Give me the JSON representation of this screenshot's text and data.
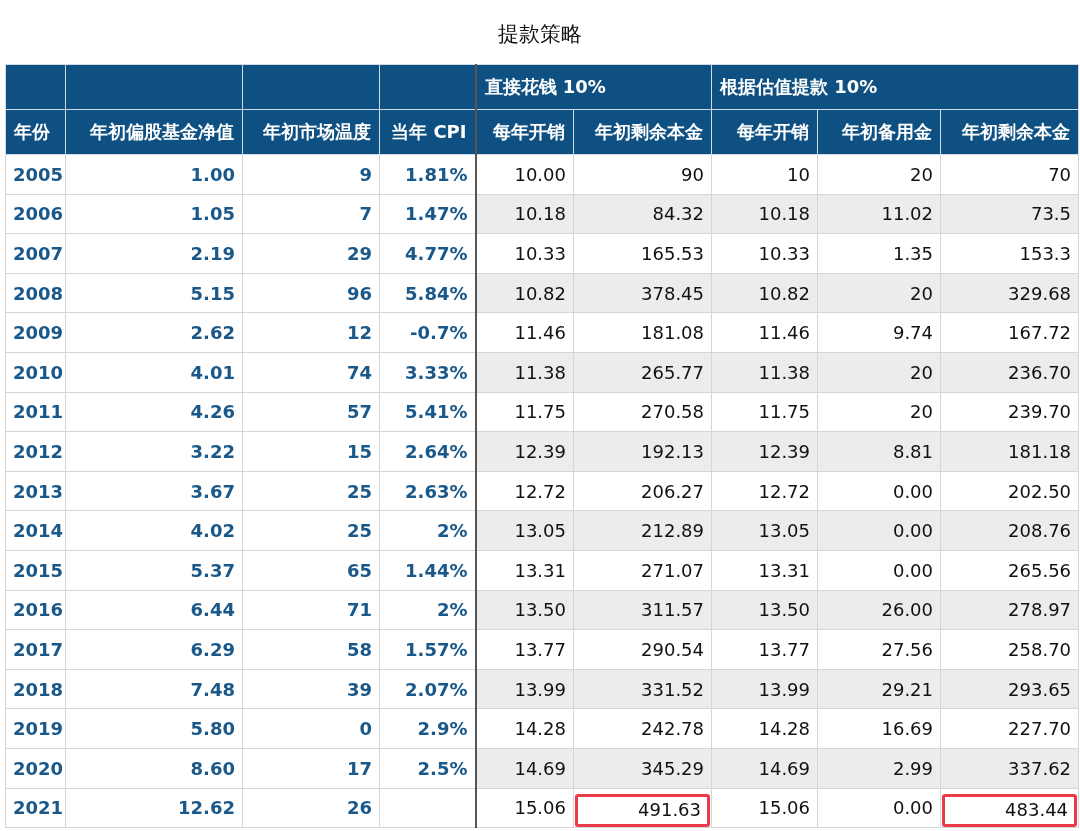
{
  "title": "提款策略",
  "groups": [
    {
      "label": "直接花钱 10%"
    },
    {
      "label": "根据估值提款 10%"
    }
  ],
  "columns": [
    "年份",
    "年初偏股基金净值",
    "年初市场温度",
    "当年 CPI",
    "每年开销",
    "年初剩余本金",
    "每年开销",
    "年初备用金",
    "年初剩余本金"
  ],
  "rows": [
    {
      "year": "2005",
      "nav": "1.00",
      "temp": "9",
      "cpi": "1.81%",
      "spend_a": "10.00",
      "remain_a": "90",
      "spend_b": "10",
      "reserve_b": "20",
      "remain_b": "70",
      "shaded": false,
      "highlighted": false
    },
    {
      "year": "2006",
      "nav": "1.05",
      "temp": "7",
      "cpi": "1.47%",
      "spend_a": "10.18",
      "remain_a": "84.32",
      "spend_b": "10.18",
      "reserve_b": "11.02",
      "remain_b": "73.5",
      "shaded": true,
      "highlighted": false
    },
    {
      "year": "2007",
      "nav": "2.19",
      "temp": "29",
      "cpi": "4.77%",
      "spend_a": "10.33",
      "remain_a": "165.53",
      "spend_b": "10.33",
      "reserve_b": "1.35",
      "remain_b": "153.3",
      "shaded": false,
      "highlighted": false
    },
    {
      "year": "2008",
      "nav": "5.15",
      "temp": "96",
      "cpi": "5.84%",
      "spend_a": "10.82",
      "remain_a": "378.45",
      "spend_b": "10.82",
      "reserve_b": "20",
      "remain_b": "329.68",
      "shaded": true,
      "highlighted": false
    },
    {
      "year": "2009",
      "nav": "2.62",
      "temp": "12",
      "cpi": "-0.7%",
      "spend_a": "11.46",
      "remain_a": "181.08",
      "spend_b": "11.46",
      "reserve_b": "9.74",
      "remain_b": "167.72",
      "shaded": false,
      "highlighted": false
    },
    {
      "year": "2010",
      "nav": "4.01",
      "temp": "74",
      "cpi": "3.33%",
      "spend_a": "11.38",
      "remain_a": "265.77",
      "spend_b": "11.38",
      "reserve_b": "20",
      "remain_b": "236.70",
      "shaded": true,
      "highlighted": false
    },
    {
      "year": "2011",
      "nav": "4.26",
      "temp": "57",
      "cpi": "5.41%",
      "spend_a": "11.75",
      "remain_a": "270.58",
      "spend_b": "11.75",
      "reserve_b": "20",
      "remain_b": "239.70",
      "shaded": false,
      "highlighted": false
    },
    {
      "year": "2012",
      "nav": "3.22",
      "temp": "15",
      "cpi": "2.64%",
      "spend_a": "12.39",
      "remain_a": "192.13",
      "spend_b": "12.39",
      "reserve_b": "8.81",
      "remain_b": "181.18",
      "shaded": true,
      "highlighted": false
    },
    {
      "year": "2013",
      "nav": "3.67",
      "temp": "25",
      "cpi": "2.63%",
      "spend_a": "12.72",
      "remain_a": "206.27",
      "spend_b": "12.72",
      "reserve_b": "0.00",
      "remain_b": "202.50",
      "shaded": false,
      "highlighted": false
    },
    {
      "year": "2014",
      "nav": "4.02",
      "temp": "25",
      "cpi": "2%",
      "spend_a": "13.05",
      "remain_a": "212.89",
      "spend_b": "13.05",
      "reserve_b": "0.00",
      "remain_b": "208.76",
      "shaded": true,
      "highlighted": false
    },
    {
      "year": "2015",
      "nav": "5.37",
      "temp": "65",
      "cpi": "1.44%",
      "spend_a": "13.31",
      "remain_a": "271.07",
      "spend_b": "13.31",
      "reserve_b": "0.00",
      "remain_b": "265.56",
      "shaded": false,
      "highlighted": false
    },
    {
      "year": "2016",
      "nav": "6.44",
      "temp": "71",
      "cpi": "2%",
      "spend_a": "13.50",
      "remain_a": "311.57",
      "spend_b": "13.50",
      "reserve_b": "26.00",
      "remain_b": "278.97",
      "shaded": true,
      "highlighted": false
    },
    {
      "year": "2017",
      "nav": "6.29",
      "temp": "58",
      "cpi": "1.57%",
      "spend_a": "13.77",
      "remain_a": "290.54",
      "spend_b": "13.77",
      "reserve_b": "27.56",
      "remain_b": "258.70",
      "shaded": false,
      "highlighted": false
    },
    {
      "year": "2018",
      "nav": "7.48",
      "temp": "39",
      "cpi": "2.07%",
      "spend_a": "13.99",
      "remain_a": "331.52",
      "spend_b": "13.99",
      "reserve_b": "29.21",
      "remain_b": "293.65",
      "shaded": true,
      "highlighted": false
    },
    {
      "year": "2019",
      "nav": "5.80",
      "temp": "0",
      "cpi": "2.9%",
      "spend_a": "14.28",
      "remain_a": "242.78",
      "spend_b": "14.28",
      "reserve_b": "16.69",
      "remain_b": "227.70",
      "shaded": false,
      "highlighted": false
    },
    {
      "year": "2020",
      "nav": "8.60",
      "temp": "17",
      "cpi": "2.5%",
      "spend_a": "14.69",
      "remain_a": "345.29",
      "spend_b": "14.69",
      "reserve_b": "2.99",
      "remain_b": "337.62",
      "shaded": true,
      "highlighted": false
    },
    {
      "year": "2021",
      "nav": "12.62",
      "temp": "26",
      "spend_a": "15.06",
      "remain_a": "491.63",
      "spend_b": "15.06",
      "reserve_b": "0.00",
      "remain_b": "483.44",
      "shaded": false,
      "highlighted": true
    }
  ]
}
